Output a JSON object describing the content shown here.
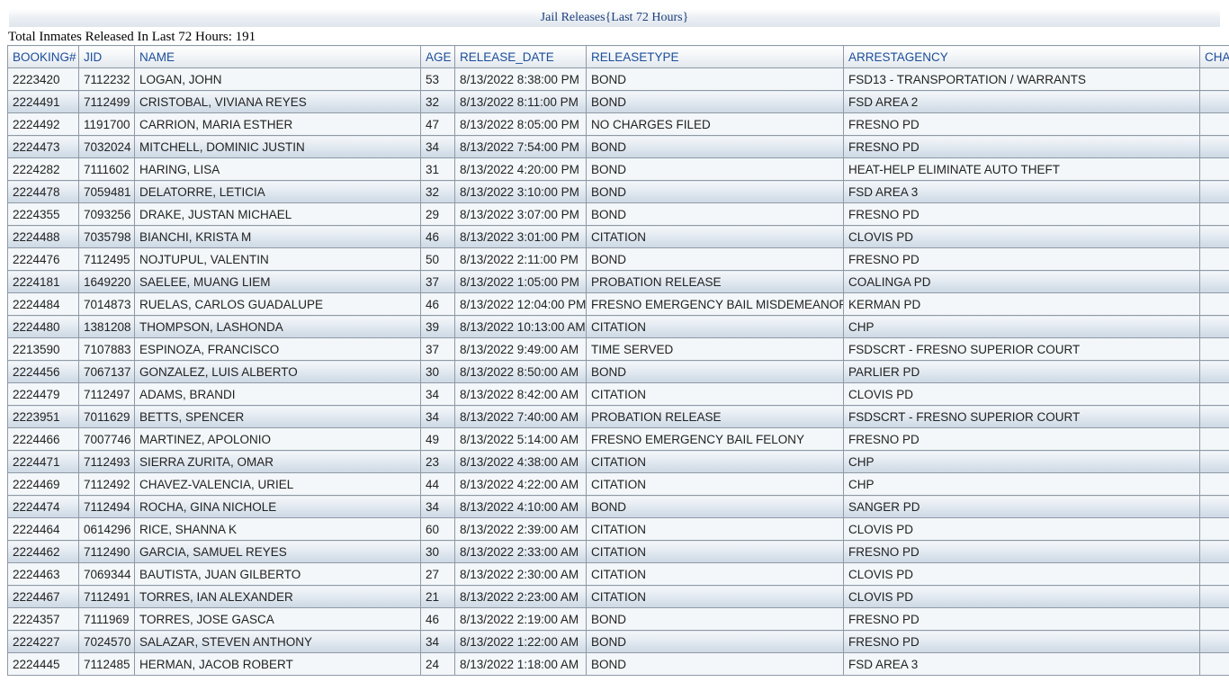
{
  "page": {
    "title": "Jail Releases{Last 72 Hours}",
    "total_line": "Total Inmates Released In Last 72 Hours: 191"
  },
  "table": {
    "headers": [
      "BOOKING#",
      "JID",
      "NAME",
      "AGE",
      "RELEASE_DATE",
      "RELEASETYPE",
      "ARRESTAGENCY",
      "CHA"
    ],
    "rows": [
      [
        "2223420",
        "7112232",
        "LOGAN, JOHN",
        "53",
        "8/13/2022 8:38:00 PM",
        "BOND",
        "FSD13 - TRANSPORTATION / WARRANTS",
        ""
      ],
      [
        "2224491",
        "7112499",
        "CRISTOBAL, VIVIANA REYES",
        "32",
        "8/13/2022 8:11:00 PM",
        "BOND",
        "FSD AREA 2",
        ""
      ],
      [
        "2224492",
        "1191700",
        "CARRION, MARIA ESTHER",
        "47",
        "8/13/2022 8:05:00 PM",
        "NO CHARGES FILED",
        "FRESNO PD",
        ""
      ],
      [
        "2224473",
        "7032024",
        "MITCHELL, DOMINIC JUSTIN",
        "34",
        "8/13/2022 7:54:00 PM",
        "BOND",
        "FRESNO PD",
        ""
      ],
      [
        "2224282",
        "7111602",
        "HARING, LISA",
        "31",
        "8/13/2022 4:20:00 PM",
        "BOND",
        "HEAT-HELP ELIMINATE AUTO THEFT",
        ""
      ],
      [
        "2224478",
        "7059481",
        "DELATORRE, LETICIA",
        "32",
        "8/13/2022 3:10:00 PM",
        "BOND",
        "FSD AREA 3",
        ""
      ],
      [
        "2224355",
        "7093256",
        "DRAKE, JUSTAN MICHAEL",
        "29",
        "8/13/2022 3:07:00 PM",
        "BOND",
        "FRESNO PD",
        ""
      ],
      [
        "2224488",
        "7035798",
        "BIANCHI, KRISTA M",
        "46",
        "8/13/2022 3:01:00 PM",
        "CITATION",
        "CLOVIS PD",
        ""
      ],
      [
        "2224476",
        "7112495",
        "NOJTUPUL, VALENTIN",
        "50",
        "8/13/2022 2:11:00 PM",
        "BOND",
        "FRESNO PD",
        ""
      ],
      [
        "2224181",
        "1649220",
        "SAELEE, MUANG LIEM",
        "37",
        "8/13/2022 1:05:00 PM",
        "PROBATION RELEASE",
        "COALINGA PD",
        ""
      ],
      [
        "2224484",
        "7014873",
        "RUELAS, CARLOS GUADALUPE",
        "46",
        "8/13/2022 12:04:00 PM",
        "FRESNO EMERGENCY BAIL MISDEMEANOR",
        "KERMAN PD",
        ""
      ],
      [
        "2224480",
        "1381208",
        "THOMPSON, LASHONDA",
        "39",
        "8/13/2022 10:13:00 AM",
        "CITATION",
        "CHP",
        ""
      ],
      [
        "2213590",
        "7107883",
        "ESPINOZA, FRANCISCO",
        "37",
        "8/13/2022 9:49:00 AM",
        "TIME SERVED",
        "FSDSCRT - FRESNO SUPERIOR COURT",
        ""
      ],
      [
        "2224456",
        "7067137",
        "GONZALEZ, LUIS ALBERTO",
        "30",
        "8/13/2022 8:50:00 AM",
        "BOND",
        "PARLIER PD",
        ""
      ],
      [
        "2224479",
        "7112497",
        "ADAMS, BRANDI",
        "34",
        "8/13/2022 8:42:00 AM",
        "CITATION",
        "CLOVIS PD",
        ""
      ],
      [
        "2223951",
        "7011629",
        "BETTS, SPENCER",
        "34",
        "8/13/2022 7:40:00 AM",
        "PROBATION RELEASE",
        "FSDSCRT - FRESNO SUPERIOR COURT",
        ""
      ],
      [
        "2224466",
        "7007746",
        "MARTINEZ, APOLONIO",
        "49",
        "8/13/2022 5:14:00 AM",
        "FRESNO EMERGENCY BAIL FELONY",
        "FRESNO PD",
        ""
      ],
      [
        "2224471",
        "7112493",
        "SIERRA ZURITA, OMAR",
        "23",
        "8/13/2022 4:38:00 AM",
        "CITATION",
        "CHP",
        ""
      ],
      [
        "2224469",
        "7112492",
        "CHAVEZ-VALENCIA, URIEL",
        "44",
        "8/13/2022 4:22:00 AM",
        "CITATION",
        "CHP",
        ""
      ],
      [
        "2224474",
        "7112494",
        "ROCHA, GINA NICHOLE",
        "34",
        "8/13/2022 4:10:00 AM",
        "BOND",
        "SANGER PD",
        ""
      ],
      [
        "2224464",
        "0614296",
        "RICE, SHANNA K",
        "60",
        "8/13/2022 2:39:00 AM",
        "CITATION",
        "CLOVIS PD",
        ""
      ],
      [
        "2224462",
        "7112490",
        "GARCIA, SAMUEL REYES",
        "30",
        "8/13/2022 2:33:00 AM",
        "CITATION",
        "FRESNO PD",
        ""
      ],
      [
        "2224463",
        "7069344",
        "BAUTISTA, JUAN GILBERTO",
        "27",
        "8/13/2022 2:30:00 AM",
        "CITATION",
        "CLOVIS PD",
        ""
      ],
      [
        "2224467",
        "7112491",
        "TORRES, IAN ALEXANDER",
        "21",
        "8/13/2022 2:23:00 AM",
        "CITATION",
        "CLOVIS PD",
        ""
      ],
      [
        "2224357",
        "7111969",
        "TORRES, JOSE GASCA",
        "46",
        "8/13/2022 2:19:00 AM",
        "BOND",
        "FRESNO PD",
        ""
      ],
      [
        "2224227",
        "7024570",
        "SALAZAR, STEVEN ANTHONY",
        "34",
        "8/13/2022 1:22:00 AM",
        "BOND",
        "FRESNO PD",
        ""
      ],
      [
        "2224445",
        "7112485",
        "HERMAN, JACOB ROBERT",
        "24",
        "8/13/2022 1:18:00 AM",
        "BOND",
        "FSD AREA 3",
        ""
      ]
    ]
  }
}
